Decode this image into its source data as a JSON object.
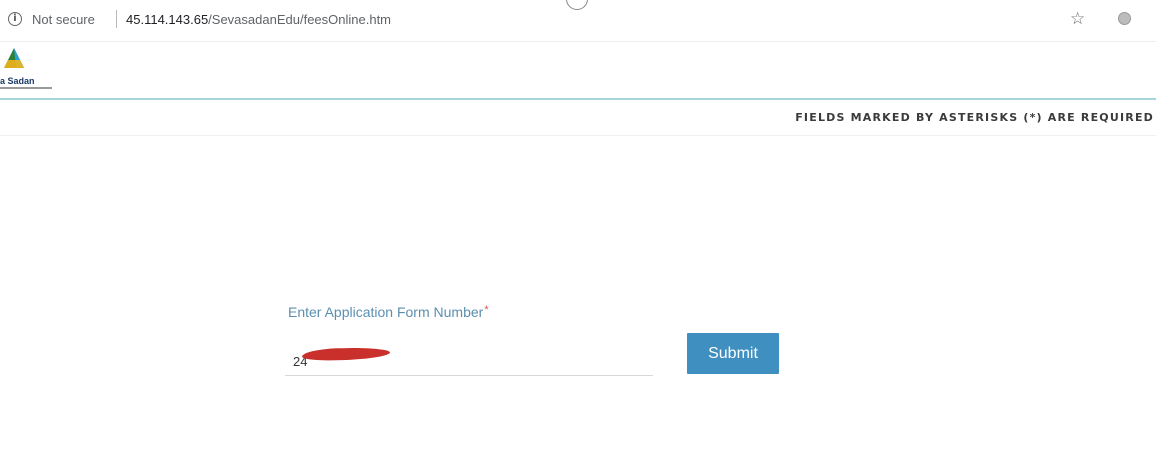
{
  "browser": {
    "security_label": "Not secure",
    "url_host": "45.114.143.65",
    "url_path": "/SevasadanEdu/feesOnline.htm",
    "info_glyph": "i",
    "star_icon": "star-icon"
  },
  "header": {
    "logo_text": "a Sadan"
  },
  "notice": {
    "required_text": "FIELDS MARKED BY ASTERISKS (*) ARE REQUIRED"
  },
  "form": {
    "application_label": "Enter Application Form Number",
    "required_marker": "*",
    "application_value": "24",
    "submit_label": "Submit"
  },
  "colors": {
    "accent": "#3f8fc0",
    "label": "#5b8fb0",
    "required": "#d9534f",
    "header_line": "#a7d3dd"
  }
}
